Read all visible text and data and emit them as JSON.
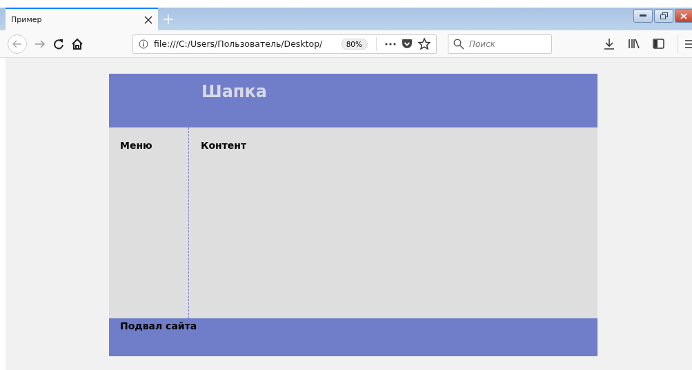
{
  "tabs": [
    {
      "title": "Пример",
      "selected": true
    }
  ],
  "address_bar": {
    "url": "file:///C:/Users/Пользователь/Desktop/",
    "zoom": "80%"
  },
  "search": {
    "placeholder": "Поиск"
  },
  "page": {
    "header": "Шапка",
    "menu": "Меню",
    "content": "Контент",
    "footer": "Подвал сайта"
  }
}
